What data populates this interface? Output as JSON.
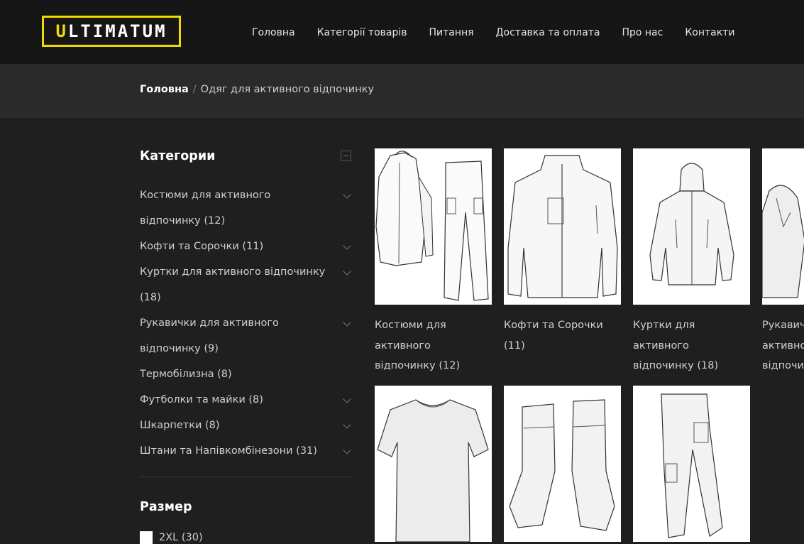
{
  "header": {
    "logo": "ULTIMATUM",
    "logo_first": "U",
    "logo_rest": "LTIMATUM",
    "nav": [
      "Головна",
      "Категорії товарів",
      "Питання",
      "Доставка та оплата",
      "Про нас",
      "Контакти"
    ]
  },
  "breadcrumb": {
    "home": "Головна",
    "separator": "/",
    "current": "Одяг для активного відпочинку"
  },
  "sidebar": {
    "categories_title": "Категории",
    "categories": [
      {
        "label": "Костюми для активного відпочинку",
        "count": "(12)"
      },
      {
        "label": "Кофти та Сорочки",
        "count": "(11)"
      },
      {
        "label": "Куртки для активного відпочинку",
        "count": "(18)"
      },
      {
        "label": "Рукавички для активного відпочинку",
        "count": "(9)"
      },
      {
        "label": "Термобілизна",
        "count": "(8)"
      },
      {
        "label": "Футболки та майки",
        "count": "(8)"
      },
      {
        "label": "Шкарпетки",
        "count": "(8)"
      },
      {
        "label": "Штани та Напівкомбінезони",
        "count": "(31)"
      }
    ],
    "size_title": "Размер",
    "sizes": [
      {
        "label": "2XL",
        "count": "(30)"
      }
    ]
  },
  "products": [
    {
      "title": "Костюми для активного відпочинку (12)",
      "image": "suit-sketch"
    },
    {
      "title": "Кофти та Сорочки (11)",
      "image": "fleece-jacket-sketch"
    },
    {
      "title": "Куртки для активного відпочинку (18)",
      "image": "hooded-jacket-sketch"
    },
    {
      "title": "Рукавички для активного відпочинку",
      "image": "glove-sketch"
    },
    {
      "title": "",
      "image": "tshirt-sketch"
    },
    {
      "title": "",
      "image": "socks-sketch"
    },
    {
      "title": "",
      "image": "pants-sketch"
    }
  ],
  "colors": {
    "background": "#1f1f1f",
    "header": "#161616",
    "breadcrumb_band": "#2a2a2a",
    "logo_accent": "#f2d900"
  }
}
